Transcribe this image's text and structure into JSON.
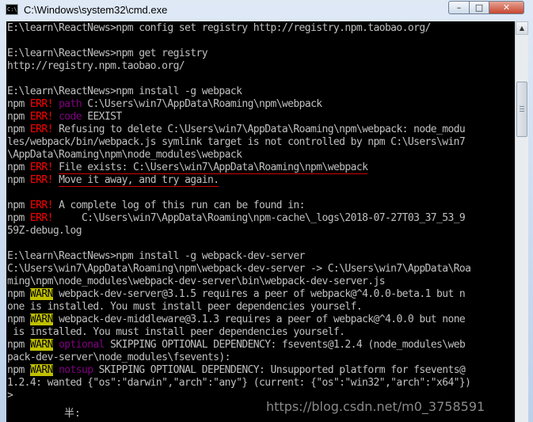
{
  "window": {
    "title": "C:\\Windows\\system32\\cmd.exe",
    "icon": "cmd-icon",
    "controls": {
      "minimize": "–",
      "maximize": "□",
      "close": "✕"
    }
  },
  "console": {
    "lines": [
      [
        {
          "t": "E:\\learn\\ReactNews>npm config set registry http://registry.npm.taobao.org/"
        }
      ],
      [
        {
          "t": ""
        }
      ],
      [
        {
          "t": "E:\\learn\\ReactNews>npm get registry"
        }
      ],
      [
        {
          "t": "http://registry.npm.taobao.org/"
        }
      ],
      [
        {
          "t": ""
        }
      ],
      [
        {
          "t": "E:\\learn\\ReactNews>npm install -g webpack"
        }
      ],
      [
        {
          "t": "npm "
        },
        {
          "t": "ERR!",
          "c": "hl-red"
        },
        {
          "t": " "
        },
        {
          "t": "path",
          "c": "hl-purple"
        },
        {
          "t": " C:\\Users\\win7\\AppData\\Roaming\\npm\\webpack"
        }
      ],
      [
        {
          "t": "npm "
        },
        {
          "t": "ERR!",
          "c": "hl-red"
        },
        {
          "t": " "
        },
        {
          "t": "code",
          "c": "hl-purple"
        },
        {
          "t": " EEXIST"
        }
      ],
      [
        {
          "t": "npm "
        },
        {
          "t": "ERR!",
          "c": "hl-red"
        },
        {
          "t": " Refusing to delete C:\\Users\\win7\\AppData\\Roaming\\npm\\webpack: node_modu"
        }
      ],
      [
        {
          "t": "les/webpack/bin/webpack.js symlink target is not controlled by npm C:\\Users\\win7"
        }
      ],
      [
        {
          "t": "\\AppData\\Roaming\\npm\\node_modules\\webpack"
        }
      ],
      [
        {
          "t": "npm "
        },
        {
          "t": "ERR!",
          "c": "hl-red"
        },
        {
          "t": " "
        },
        {
          "t": "File exists: C:\\Users\\win7\\AppData\\Roaming\\npm\\webpack",
          "c": "ul"
        }
      ],
      [
        {
          "t": "npm "
        },
        {
          "t": "ERR!",
          "c": "hl-red"
        },
        {
          "t": " "
        },
        {
          "t": "Move it away, and try again.",
          "c": "ul"
        }
      ],
      [
        {
          "t": ""
        }
      ],
      [
        {
          "t": "npm "
        },
        {
          "t": "ERR!",
          "c": "hl-red"
        },
        {
          "t": " A complete log of this run can be found in:"
        }
      ],
      [
        {
          "t": "npm "
        },
        {
          "t": "ERR!",
          "c": "hl-red"
        },
        {
          "t": "     C:\\Users\\win7\\AppData\\Roaming\\npm-cache\\_logs\\2018-07-27T03_37_53_9"
        }
      ],
      [
        {
          "t": "59Z-debug.log"
        }
      ],
      [
        {
          "t": ""
        }
      ],
      [
        {
          "t": "E:\\learn\\ReactNews>npm install -g webpack-dev-server"
        }
      ],
      [
        {
          "t": "C:\\Users\\win7\\AppData\\Roaming\\npm\\webpack-dev-server -> C:\\Users\\win7\\AppData\\Roa"
        }
      ],
      [
        {
          "t": "ming\\npm\\node_modules\\webpack-dev-server\\bin\\webpack-dev-server.js"
        }
      ],
      [
        {
          "t": "npm "
        },
        {
          "t": "WARN",
          "c": "hl-warn"
        },
        {
          "t": " webpack-dev-server@3.1.5 requires a peer of webpack@^4.0.0-beta.1 but n"
        }
      ],
      [
        {
          "t": "one is installed. You must install peer dependencies yourself."
        }
      ],
      [
        {
          "t": "npm "
        },
        {
          "t": "WARN",
          "c": "hl-warn"
        },
        {
          "t": " webpack-dev-middleware@3.1.3 requires a peer of webpack@^4.0.0 but none"
        }
      ],
      [
        {
          "t": " is installed. You must install peer dependencies yourself."
        }
      ],
      [
        {
          "t": "npm "
        },
        {
          "t": "WARN",
          "c": "hl-warn"
        },
        {
          "t": " "
        },
        {
          "t": "optional",
          "c": "hl-purple"
        },
        {
          "t": " SKIPPING OPTIONAL DEPENDENCY: fsevents@1.2.4 (node_modules\\web"
        }
      ],
      [
        {
          "t": "pack-dev-server\\node_modules\\fsevents):"
        }
      ],
      [
        {
          "t": "npm "
        },
        {
          "t": "WARN",
          "c": "hl-warn"
        },
        {
          "t": " "
        },
        {
          "t": "notsup",
          "c": "hl-purple"
        },
        {
          "t": " SKIPPING OPTIONAL DEPENDENCY: Unsupported platform for fsevents@"
        }
      ],
      [
        {
          "t": "1.2.4: wanted {\"os\":\"darwin\",\"arch\":\"any\"} (current: {\"os\":\"win32\",\"arch\":\"x64\"})"
        }
      ],
      [
        {
          "t": ">"
        }
      ]
    ],
    "ime_status": "半:",
    "watermark": "https://blog.csdn.net/m0_3758591"
  },
  "scrollbar": {
    "up_arrow": "▲"
  },
  "colors": {
    "console_bg": "#000000",
    "text": "#c0c0c0",
    "err": "#ff0000",
    "warn_bg": "#c0c000",
    "keyword": "#800080",
    "underline": "#d00000"
  }
}
